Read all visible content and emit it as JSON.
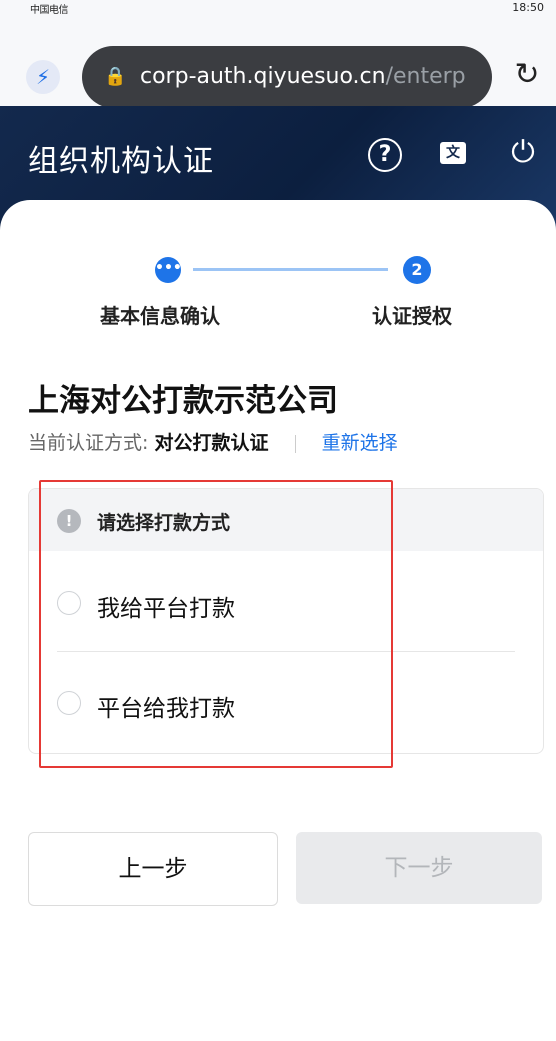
{
  "status_bar": {
    "carrier": "中国电信",
    "time": "18:50"
  },
  "browser": {
    "url_main": "corp-auth.qiyuesuo.cn",
    "url_rest": "/enterp"
  },
  "header": {
    "title": "组织机构认证"
  },
  "stepper": {
    "step1_label": "基本信息确认",
    "step1_glyph": "•••",
    "step2_number": "2",
    "step2_label": "认证授权"
  },
  "company": {
    "name": "上海对公打款示范公司",
    "method_prefix": "当前认证方式:",
    "method_value": "对公打款认证",
    "reselect": "重新选择"
  },
  "payment": {
    "header": "请选择打款方式",
    "options": [
      "我给平台打款",
      "平台给我打款"
    ]
  },
  "buttons": {
    "prev": "上一步",
    "next": "下一步"
  },
  "colors": {
    "accent": "#1e74e8",
    "header_bg": "#13294d",
    "highlight": "#e53935"
  }
}
